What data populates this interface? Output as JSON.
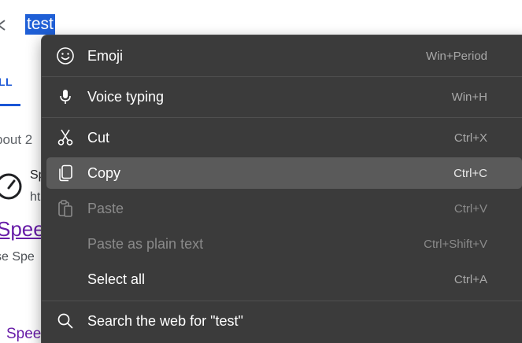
{
  "search": {
    "query": "test"
  },
  "background": {
    "tab_all": "LL",
    "result_count": "bout 2",
    "site_name": "Sp",
    "site_url": "ht",
    "result_title": "Spee",
    "result_snippet": "se Spe",
    "result_sublink": "Spee"
  },
  "menu": {
    "items": [
      {
        "label": "Emoji",
        "shortcut": "Win+Period",
        "icon": "smiley-icon"
      },
      {
        "label": "Voice typing",
        "shortcut": "Win+H",
        "icon": "microphone-icon"
      },
      {
        "label": "Cut",
        "shortcut": "Ctrl+X",
        "icon": "scissors-icon"
      },
      {
        "label": "Copy",
        "shortcut": "Ctrl+C",
        "icon": "copy-icon"
      },
      {
        "label": "Paste",
        "shortcut": "Ctrl+V",
        "icon": "clipboard-icon"
      },
      {
        "label": "Paste as plain text",
        "shortcut": "Ctrl+Shift+V"
      },
      {
        "label": "Select all",
        "shortcut": "Ctrl+A"
      },
      {
        "label": "Search the web for \"test\"",
        "icon": "search-icon"
      }
    ]
  },
  "colors": {
    "menu_background": "#3b3b3b",
    "menu_hover": "#5a5a5a",
    "selection": "#1f5fd6",
    "link_visited": "#681da8",
    "tab_accent": "#1a56d6"
  }
}
